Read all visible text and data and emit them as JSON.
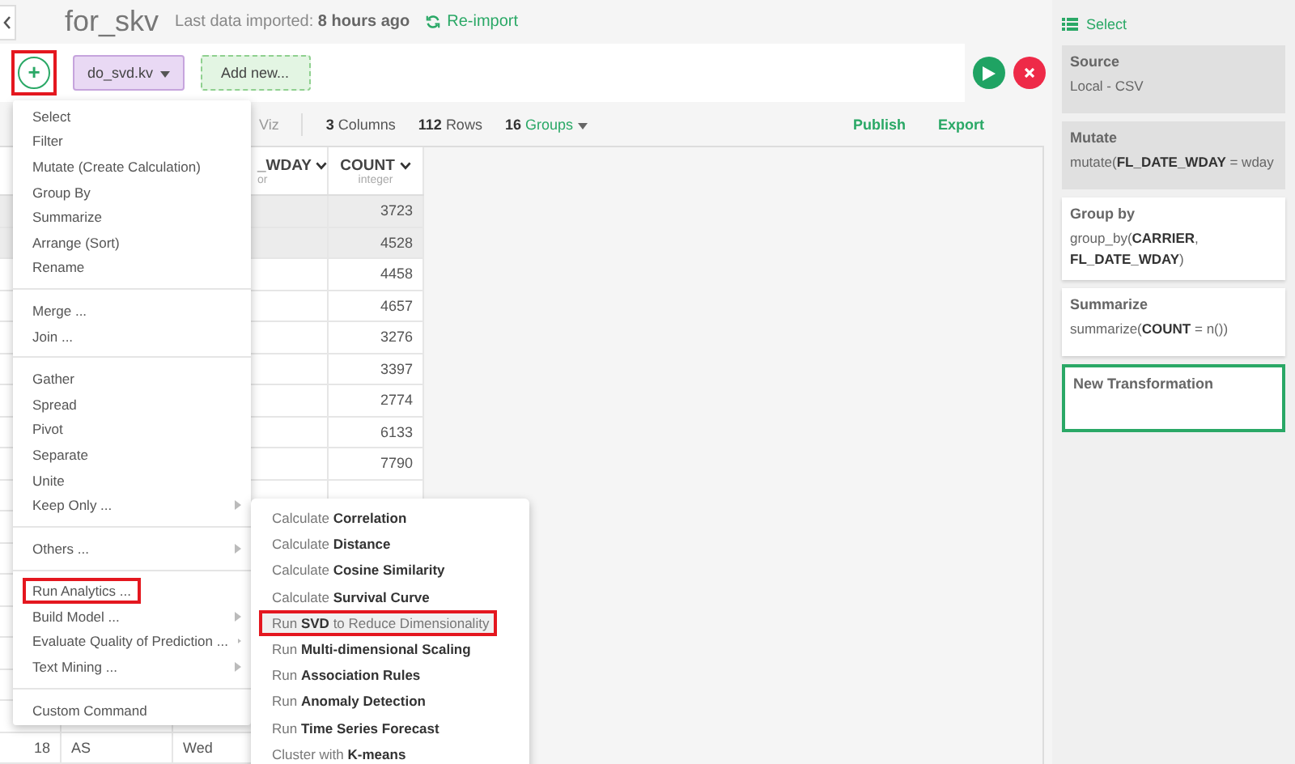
{
  "header": {
    "title": "for_skv",
    "imported": "Last data imported: **8 hours ago**",
    "reimport": "Re-import"
  },
  "toolbar": {
    "add_button": {
      "symbol": "+",
      "highlighted": true
    },
    "tabs": [
      {
        "label": "do_svd.kv",
        "selected": true,
        "kind": "tab"
      },
      {
        "label": "Add new...",
        "selected": false,
        "kind": "new"
      }
    ]
  },
  "stats": {
    "viz": "Viz",
    "items": [
      {
        "count": "3",
        "label": "Columns",
        "kind": "plain"
      },
      {
        "count": "112",
        "label": "Rows",
        "kind": "plain"
      },
      {
        "count": "16",
        "label": "Groups",
        "kind": "dropdown"
      }
    ],
    "actions": [
      "Publish",
      "Export"
    ]
  },
  "table": {
    "columns": [
      {
        "name": "_WDAY",
        "type": "or"
      },
      {
        "name": "COUNT",
        "type": "integer"
      }
    ],
    "rows": [
      {
        "count": "3723",
        "shaded": true
      },
      {
        "count": "4528",
        "shaded": true
      },
      {
        "count": "4458",
        "shaded": false
      },
      {
        "count": "4657",
        "shaded": false
      },
      {
        "count": "3276",
        "shaded": false
      },
      {
        "count": "3397",
        "shaded": false
      },
      {
        "count": "2774",
        "shaded": false
      },
      {
        "count": "6133",
        "shaded": false
      },
      {
        "count": "7790",
        "shaded": false
      }
    ],
    "last_row": {
      "number": "18",
      "carrier": "AS",
      "day": "Wed"
    }
  },
  "menu": {
    "sections": [
      {
        "items": [
          {
            "label": "Select",
            "submenu": false,
            "highlighted": false
          },
          {
            "label": "Filter",
            "submenu": false,
            "highlighted": false
          },
          {
            "label": "Mutate (Create Calculation)",
            "submenu": false,
            "highlighted": false
          },
          {
            "label": "Group By",
            "submenu": false,
            "highlighted": false
          },
          {
            "label": "Summarize",
            "submenu": false,
            "highlighted": false
          },
          {
            "label": "Arrange (Sort)",
            "submenu": false,
            "highlighted": false
          },
          {
            "label": "Rename",
            "submenu": false,
            "highlighted": false
          }
        ]
      },
      {
        "items": [
          {
            "label": "Merge ...",
            "submenu": false,
            "highlighted": false
          },
          {
            "label": "Join ...",
            "submenu": false,
            "highlighted": false
          }
        ]
      },
      {
        "items": [
          {
            "label": "Gather",
            "submenu": false,
            "highlighted": false
          },
          {
            "label": "Spread",
            "submenu": false,
            "highlighted": false
          },
          {
            "label": "Pivot",
            "submenu": false,
            "highlighted": false
          },
          {
            "label": "Separate",
            "submenu": false,
            "highlighted": false
          },
          {
            "label": "Unite",
            "submenu": false,
            "highlighted": false
          },
          {
            "label": "Keep Only ...",
            "submenu": true,
            "highlighted": false
          }
        ]
      },
      {
        "items": [
          {
            "label": "Others ...",
            "submenu": true,
            "highlighted": false
          }
        ]
      },
      {
        "items": [
          {
            "label": "Run Analytics ...",
            "submenu": false,
            "highlighted": true
          },
          {
            "label": "Build Model ...",
            "submenu": true,
            "highlighted": false
          },
          {
            "label": "Evaluate Quality of Prediction ...",
            "submenu": true,
            "highlighted": false
          },
          {
            "label": "Text Mining ...",
            "submenu": true,
            "highlighted": false
          }
        ]
      },
      {
        "items": [
          {
            "label": "Custom Command",
            "submenu": false,
            "highlighted": false
          }
        ]
      }
    ]
  },
  "submenu": {
    "items": [
      {
        "label": "Calculate **Correlation**",
        "hovered": false,
        "highlighted": false
      },
      {
        "label": "Calculate **Distance**",
        "hovered": false,
        "highlighted": false
      },
      {
        "label": "Calculate **Cosine Similarity**",
        "hovered": false,
        "highlighted": false
      },
      {
        "label": "Calculate **Survival Curve**",
        "hovered": false,
        "highlighted": false
      },
      {
        "label": "Run **SVD** to Reduce Dimensionality",
        "hovered": true,
        "highlighted": true
      },
      {
        "label": "Run **Multi-dimensional Scaling**",
        "hovered": false,
        "highlighted": false
      },
      {
        "label": "Run **Association Rules**",
        "hovered": false,
        "highlighted": false
      },
      {
        "label": "Run **Anomaly Detection**",
        "hovered": false,
        "highlighted": false
      },
      {
        "label": "Run **Time Series Forecast**",
        "hovered": false,
        "highlighted": false
      },
      {
        "label": "Cluster with **K-means**",
        "hovered": false,
        "highlighted": false
      }
    ]
  },
  "sidebar": {
    "select": "Select",
    "steps": [
      {
        "title": "Source",
        "body": "Local - CSV",
        "kind": "shaded"
      },
      {
        "title": "Mutate",
        "body": "mutate(**FL_DATE_WDAY** = wday",
        "kind": "shaded"
      },
      {
        "title": "Group by",
        "body": "group_by(**CARRIER**, **FL_DATE_WDAY**)",
        "kind": "plain"
      },
      {
        "title": "Summarize",
        "body": "summarize(**COUNT** = n())",
        "kind": "plain"
      },
      {
        "title": "New Transformation",
        "kind": "new"
      }
    ]
  }
}
